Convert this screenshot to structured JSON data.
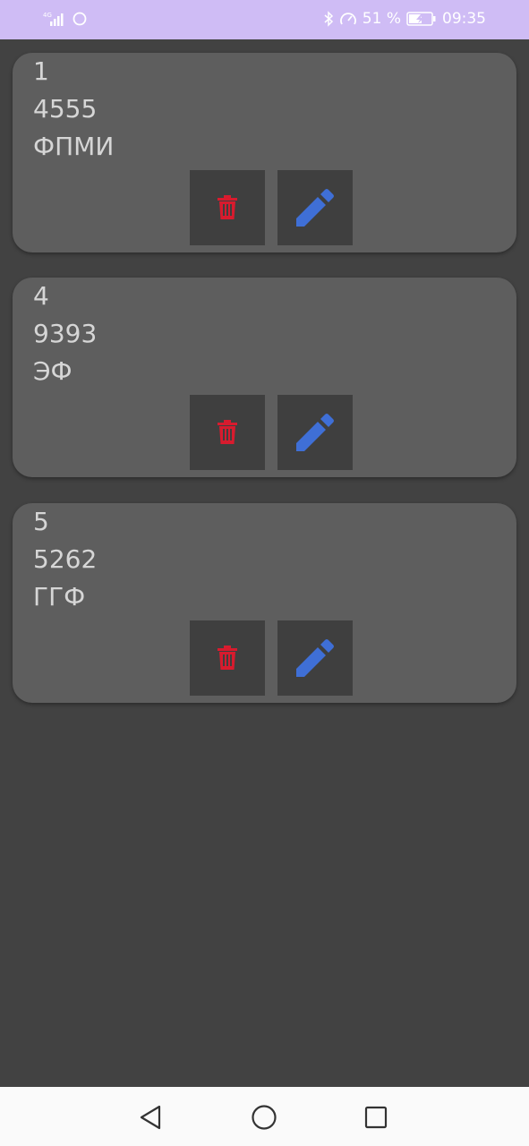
{
  "status_bar": {
    "network": "4G",
    "battery_percent": "51 %",
    "time": "09:35",
    "background_color": "#cfbcf5",
    "icons": [
      "signal-icon",
      "sync-icon",
      "bluetooth-icon",
      "speedometer-icon",
      "battery-charging-icon"
    ]
  },
  "cards": [
    {
      "id": "1",
      "number": "4555",
      "faculty": "ФПМИ"
    },
    {
      "id": "4",
      "number": "9393",
      "faculty": "ЭФ"
    },
    {
      "id": "5",
      "number": "5262",
      "faculty": "ГГФ"
    }
  ],
  "actions": {
    "delete_icon": "trash-icon",
    "edit_icon": "pencil-icon",
    "delete_color": "#d81b2e",
    "edit_color": "#3f6fd6"
  },
  "nav_bar": {
    "icons": [
      "back-triangle-icon",
      "home-circle-icon",
      "recents-square-icon"
    ]
  },
  "colors": {
    "background": "#424242",
    "card": "#5e5e5e",
    "button": "#3f3f3f",
    "text": "#d6d6d6"
  }
}
